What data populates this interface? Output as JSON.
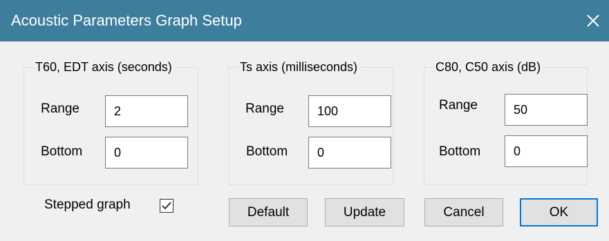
{
  "window": {
    "title": "Acoustic Parameters Graph Setup",
    "titlebar_color": "#3e7e9d"
  },
  "groups": [
    {
      "legend": "T60, EDT axis (seconds)",
      "range_label": "Range",
      "range_value": "2",
      "bottom_label": "Bottom",
      "bottom_value": "0"
    },
    {
      "legend": "Ts axis (milliseconds)",
      "range_label": "Range",
      "range_value": "100",
      "bottom_label": "Bottom",
      "bottom_value": "0"
    },
    {
      "legend": "C80, C50 axis (dB)",
      "range_label": "Range",
      "range_value": "50",
      "bottom_label": "Bottom",
      "bottom_value": "0"
    }
  ],
  "stepped_graph": {
    "label": "Stepped graph",
    "checked": true
  },
  "buttons": {
    "default_label": "Default",
    "update_label": "Update",
    "cancel_label": "Cancel",
    "ok_label": "OK"
  },
  "icons": {
    "close": "close-icon",
    "check": "check-icon"
  }
}
